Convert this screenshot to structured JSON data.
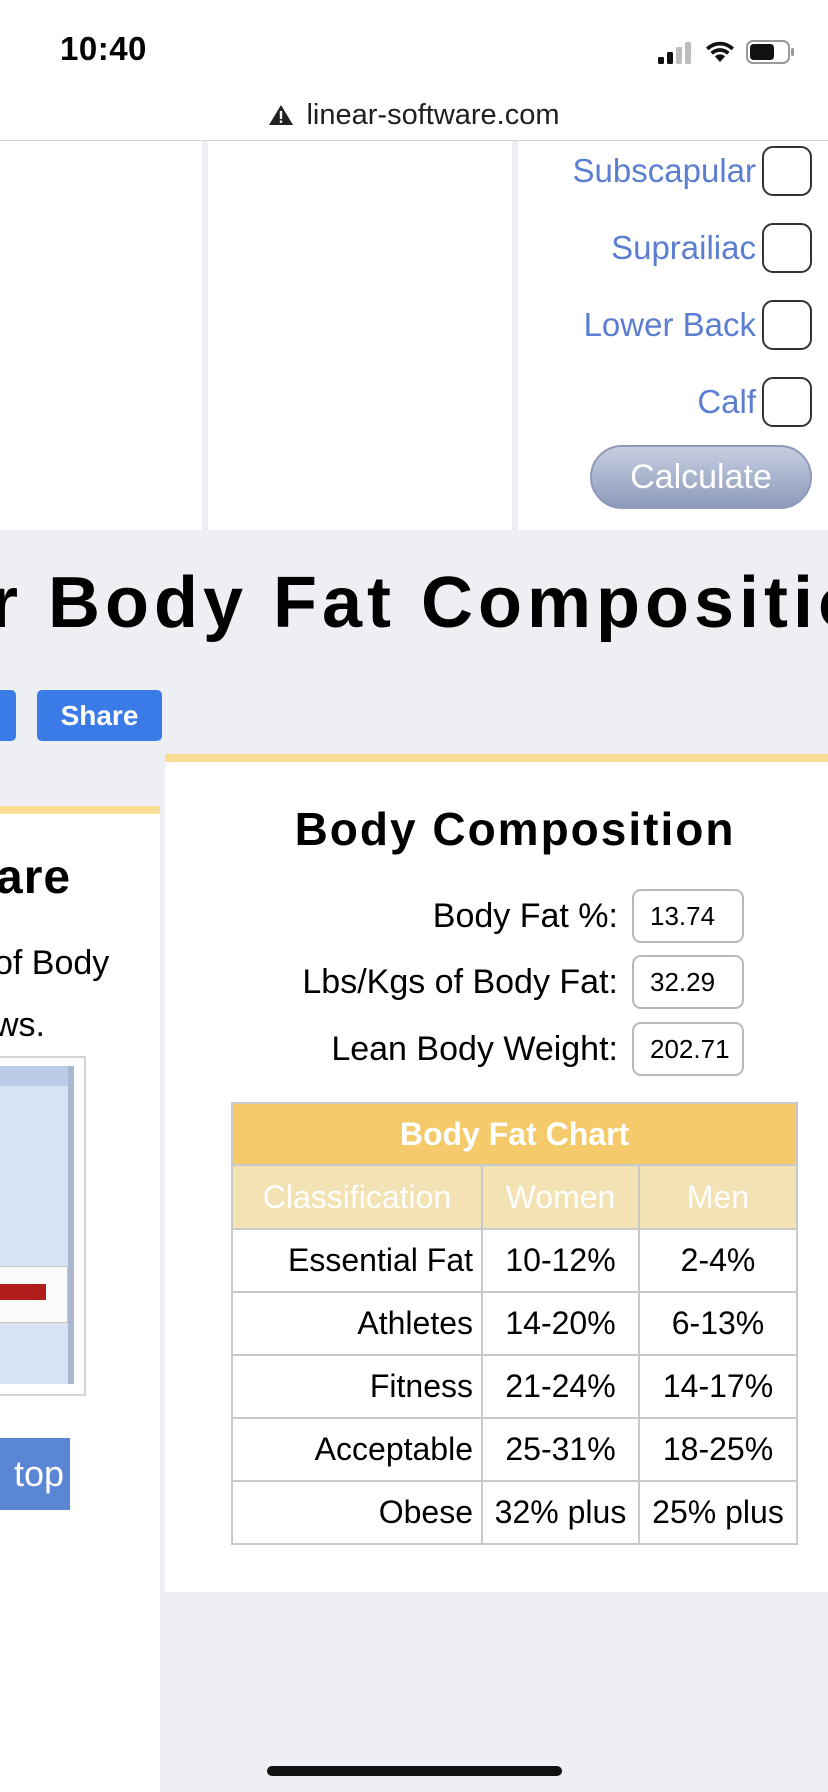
{
  "status_bar": {
    "time": "10:40"
  },
  "browser": {
    "url": "linear-software.com"
  },
  "form": {
    "checkboxes": [
      {
        "label": "Subscapular",
        "checked": false
      },
      {
        "label": "Suprailiac",
        "checked": false
      },
      {
        "label": "Lower Back",
        "checked": false
      },
      {
        "label": "Calf",
        "checked": false
      }
    ],
    "calculate_label": "Calculate"
  },
  "heading": "r Body Fat Compositio",
  "share_label": "Share",
  "left_panel": {
    "title": "are",
    "line1": "of Body",
    "line2": "ws.",
    "button_label": "top"
  },
  "composition": {
    "title": "Body Composition",
    "fields": [
      {
        "label": "Body Fat %:",
        "value": "13.74"
      },
      {
        "label": "Lbs/Kgs of Body Fat:",
        "value": "32.29"
      },
      {
        "label": "Lean Body Weight:",
        "value": "202.71"
      }
    ],
    "chart": {
      "title": "Body Fat Chart",
      "headers": [
        "Classification",
        "Women",
        "Men"
      ],
      "rows": [
        [
          "Essential Fat",
          "10-12%",
          "2-4%"
        ],
        [
          "Athletes",
          "14-20%",
          "6-13%"
        ],
        [
          "Fitness",
          "21-24%",
          "14-17%"
        ],
        [
          "Acceptable",
          "25-31%",
          "18-25%"
        ],
        [
          "Obese",
          "32% plus",
          "25% plus"
        ]
      ]
    }
  },
  "colors": {
    "link_blue": "#5b7ed0",
    "share_blue": "#3b7be8",
    "accent_yellow": "#f9dd94",
    "chart_title_bg": "#f5ca6b",
    "chart_header_bg": "#f3e2b4"
  }
}
